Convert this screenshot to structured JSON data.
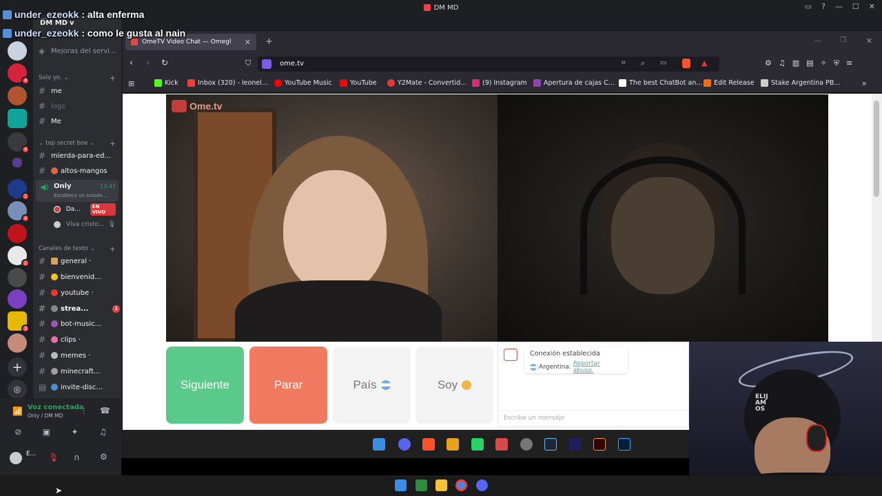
{
  "discord": {
    "window_title": "DM MD",
    "server_name": "DM MD",
    "server_dropdown": "v",
    "mejoras": "Mejoras del servi...",
    "section_solo": "Solo yo.",
    "section_topsecret": "top secret boe",
    "section_canales": "Canales de texto",
    "channels_solo": [
      {
        "label": "me"
      },
      {
        "label": "logs"
      },
      {
        "label": "Me"
      }
    ],
    "channels_topsecret": [
      {
        "label": "mierda-para-ed..."
      },
      {
        "label": "altos-mangos"
      }
    ],
    "voice_channel": {
      "label": "Only",
      "time": "13:47",
      "status": "Establece un estado ..."
    },
    "voice_members": [
      {
        "name": "Da...",
        "badge": "EN VIVO"
      },
      {
        "name": "Viva cristo..."
      }
    ],
    "text_channels": [
      {
        "label": "general ·"
      },
      {
        "label": "bienvenid..."
      },
      {
        "label": "youtube ·"
      },
      {
        "label": "strea...",
        "unread": "1"
      },
      {
        "label": "bot-music..."
      },
      {
        "label": "clips ·"
      },
      {
        "label": "memes ·"
      },
      {
        "label": "minecraft..."
      },
      {
        "label": "invite-disc..."
      }
    ],
    "voice_status": "Voz conectada",
    "voice_location": "Only / DM MD",
    "user_name": "E..."
  },
  "overlay_chat": [
    {
      "user": "under_ezeokk",
      "text": ": alta enferma"
    },
    {
      "user": "under_ezeokk",
      "text": ": como le gusta al nain"
    }
  ],
  "browser": {
    "tab_title": "OmeTV Video Chat — Omegl",
    "url": "ome.tv",
    "bookmarks": [
      {
        "label": "Kick",
        "color": "#53fc18"
      },
      {
        "label": "Inbox (320) - leonel...",
        "color": "#ea4335"
      },
      {
        "label": "YouTube Music",
        "color": "#ff0000"
      },
      {
        "label": "YouTube",
        "color": "#ff0000"
      },
      {
        "label": "Y2Mate - Convertid...",
        "color": "#e53935"
      },
      {
        "label": "(9) Instagram",
        "color": "#d62976"
      },
      {
        "label": "Apertura de cajas C...",
        "color": "#8e44ad"
      },
      {
        "label": "The best ChatBot an...",
        "color": "#ffffff"
      },
      {
        "label": "Edit Release",
        "color": "#ff6a00"
      },
      {
        "label": "Stake Argentina PB...",
        "color": "#cccccc"
      }
    ]
  },
  "ometv": {
    "logo": "Ome.tv",
    "btn_next": "Siguiente",
    "btn_stop": "Parar",
    "btn_country": "País",
    "btn_gender": "Soy",
    "status_connected": "Conexión establecida",
    "country": "Argentina.",
    "report_link": "Reportar abuso.",
    "message_placeholder": "Escribe un mensaje",
    "colors": {
      "next": "#5bc98a",
      "stop": "#ef7a5f",
      "neutral": "#f1f1f1"
    }
  },
  "webcam": {
    "cap_text": "ELIJ\nAM\nOS"
  }
}
